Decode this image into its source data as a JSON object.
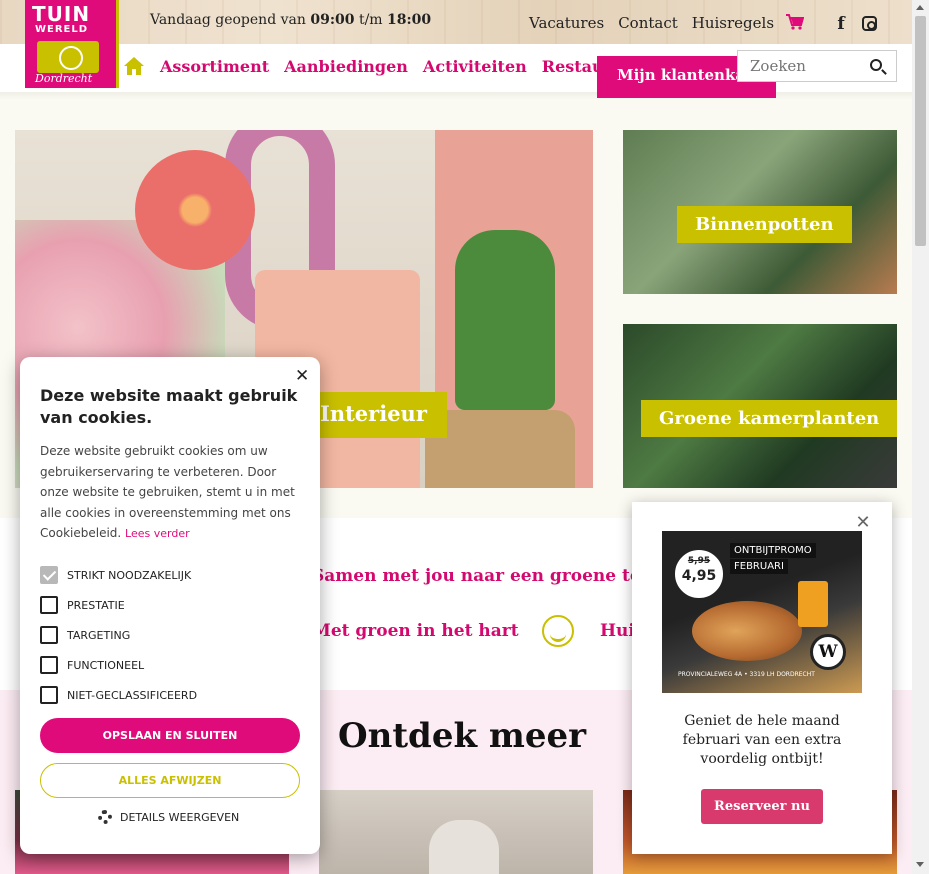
{
  "topbar": {
    "opening_prefix": "Vandaag geopend van",
    "open_from": "09:00",
    "open_sep": "t/m",
    "open_to": "18:00",
    "links": [
      "Vacatures",
      "Contact",
      "Huisregels"
    ],
    "facebook_glyph": "f"
  },
  "logo": {
    "line1": "TUIN",
    "line2": "WERELD",
    "line3": "Dordrecht"
  },
  "nav": {
    "items": [
      "Assortiment",
      "Aanbiedingen",
      "Activiteiten",
      "Restaurant"
    ],
    "account_button": "Mijn klantenkaart",
    "search_placeholder": "Zoeken"
  },
  "hero": {
    "main_label": "Interieur",
    "tiles": [
      "Binnenpotten",
      "Groene kamerplanten"
    ]
  },
  "middle": {
    "tagline": "Samen met jou naar een groene toekomst",
    "usp_hart": "Met groen in het hart",
    "usp_huis": "Huis"
  },
  "lower": {
    "heading": "Ontdek meer"
  },
  "cookie": {
    "title": "Deze website maakt gebruik van cookies.",
    "description": "Deze website gebruikt cookies om uw gebruikerservaring te verbeteren. Door onze website te gebruiken, stemt u in met alle cookies in overeenstemming met ons Cookiebeleid.",
    "read_more": "Lees verder",
    "close_glyph": "✕",
    "options": [
      {
        "label": "STRIKT NOODZAKELIJK",
        "checked": true
      },
      {
        "label": "PRESTATIE",
        "checked": false
      },
      {
        "label": "TARGETING",
        "checked": false
      },
      {
        "label": "FUNCTIONEEL",
        "checked": false
      },
      {
        "label": "NIET-GECLASSIFICEERD",
        "checked": false
      }
    ],
    "save_button": "OPSLAAN EN SLUITEN",
    "reject_button": "ALLES AFWIJZEN",
    "details_button": "DETAILS WEERGEVEN"
  },
  "promo": {
    "close_glyph": "✕",
    "image_badge_old": "5,95",
    "image_badge_new": "4,95",
    "image_tag1": "ONTBIJTPROMO",
    "image_tag2": "FEBRUARI",
    "image_logo": "W",
    "image_address": "PROVINCIALEWEG 4A • 3319 LH DORDRECHT",
    "text": "Geniet de hele maand februari van een extra voordelig ontbijt!",
    "button": "Reserveer nu"
  },
  "colors": {
    "brand_pink": "#e00b7a",
    "brand_green": "#c9c000"
  }
}
